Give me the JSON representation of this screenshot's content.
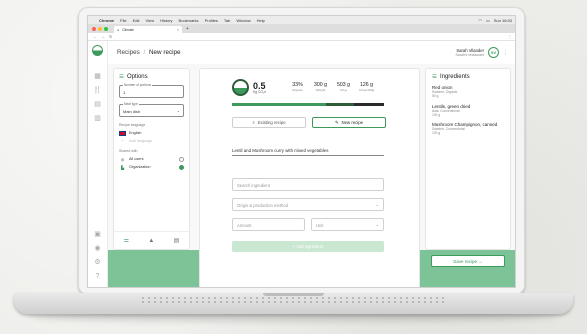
{
  "menubar": {
    "app": "Chrome",
    "items": [
      "File",
      "Edit",
      "View",
      "History",
      "Bookmarks",
      "Profiles",
      "Tab",
      "Window",
      "Help"
    ],
    "clock": "Sun 16:53"
  },
  "browser": {
    "tab_title": "Climate",
    "new_tab": "+"
  },
  "header": {
    "breadcrumb_root": "Recipes",
    "breadcrumb_sep": "/",
    "breadcrumb_current": "New recipe",
    "user_name": "Sarah Vilander",
    "user_org": "Sarah's restaurant",
    "avatar_initials": "SV"
  },
  "options": {
    "title": "Options",
    "portions_label": "Number of portions",
    "portions_value": "1",
    "meal_type_label": "Meal type",
    "meal_type_value": "Main dish",
    "recipe_language_label": "Recipe language",
    "languages": [
      {
        "label": "English",
        "selected": true
      },
      {
        "label": "Add language",
        "selected": false
      }
    ],
    "shared_with_label": "Shared with",
    "shared": [
      {
        "label": "All users",
        "checked": false
      },
      {
        "label": "Organization",
        "checked": true
      }
    ]
  },
  "impact": {
    "score": "0.5",
    "unit": "Kg CO₂e",
    "metrics": [
      {
        "value": "33%",
        "label": "Organic"
      },
      {
        "value": "300 g",
        "label": "Weight"
      },
      {
        "value": "503 g",
        "label": "CO₂e"
      },
      {
        "value": "126 g",
        "label": "CO₂e/100g"
      }
    ],
    "bar_fractions": [
      0.62,
      0.18,
      0.2
    ]
  },
  "recipe": {
    "mode_existing": "Existing recipe",
    "mode_new": "New recipe",
    "name": "Lentil and Mushroom curry with mixed vegetables",
    "search_placeholder": "Search ingredient",
    "origin_placeholder": "Origin & production method",
    "amount_placeholder": "Amount",
    "unit_placeholder": "Unit",
    "add_button": "+ Add ingredient"
  },
  "ingredients": {
    "title": "Ingredients",
    "items": [
      {
        "name": "Red onion",
        "origin": "Sweden, Organic",
        "amount": "50 g"
      },
      {
        "name": "Lentils, green dried",
        "origin": "Asia, Conventional",
        "amount": "100 g"
      },
      {
        "name": "Mushroom Champignon, canned",
        "origin": "Sweden, Conventional",
        "amount": "100 g"
      }
    ],
    "save_button": "Save recipe →"
  },
  "colors": {
    "accent": "#3d9a5c",
    "accent_dark": "#2f5d3a",
    "accent_light": "#7cc497"
  }
}
